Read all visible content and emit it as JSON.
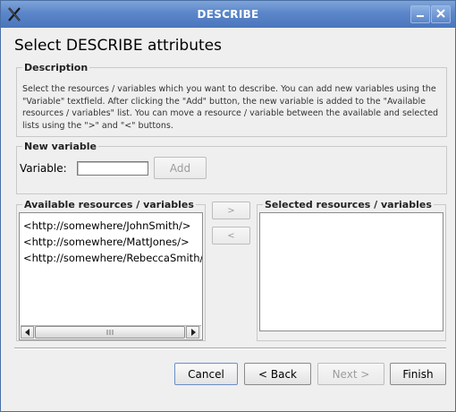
{
  "window": {
    "title": "DESCRIBE"
  },
  "heading": "Select DESCRIBE attributes",
  "description": {
    "label": "Description",
    "text": "Select the resources / variables which you want to describe. You can add new variables using the \"Variable\" textfield. After clicking the \"Add\" button, the new variable is added to the \"Available resources / variables\" list. You can move a resource / variable between the available and selected lists using the \">\" and \"<\" buttons."
  },
  "new_variable": {
    "label": "New variable",
    "field_label": "Variable:",
    "value": "",
    "add_label": "Add"
  },
  "available": {
    "label": "Available resources  / variables",
    "items": [
      "<http://somewhere/JohnSmith/>",
      "<http://somewhere/MattJones/>",
      "<http://somewhere/RebeccaSmith/>"
    ]
  },
  "move": {
    "right_label": ">",
    "left_label": "<"
  },
  "selected": {
    "label": "Selected resources  / variables",
    "items": []
  },
  "buttons": {
    "cancel": "Cancel",
    "back": "< Back",
    "next": "Next >",
    "finish": "Finish"
  },
  "icons": {
    "window_logo": "x-logo-icon",
    "minimize": "minimize-icon",
    "close": "close-icon"
  }
}
